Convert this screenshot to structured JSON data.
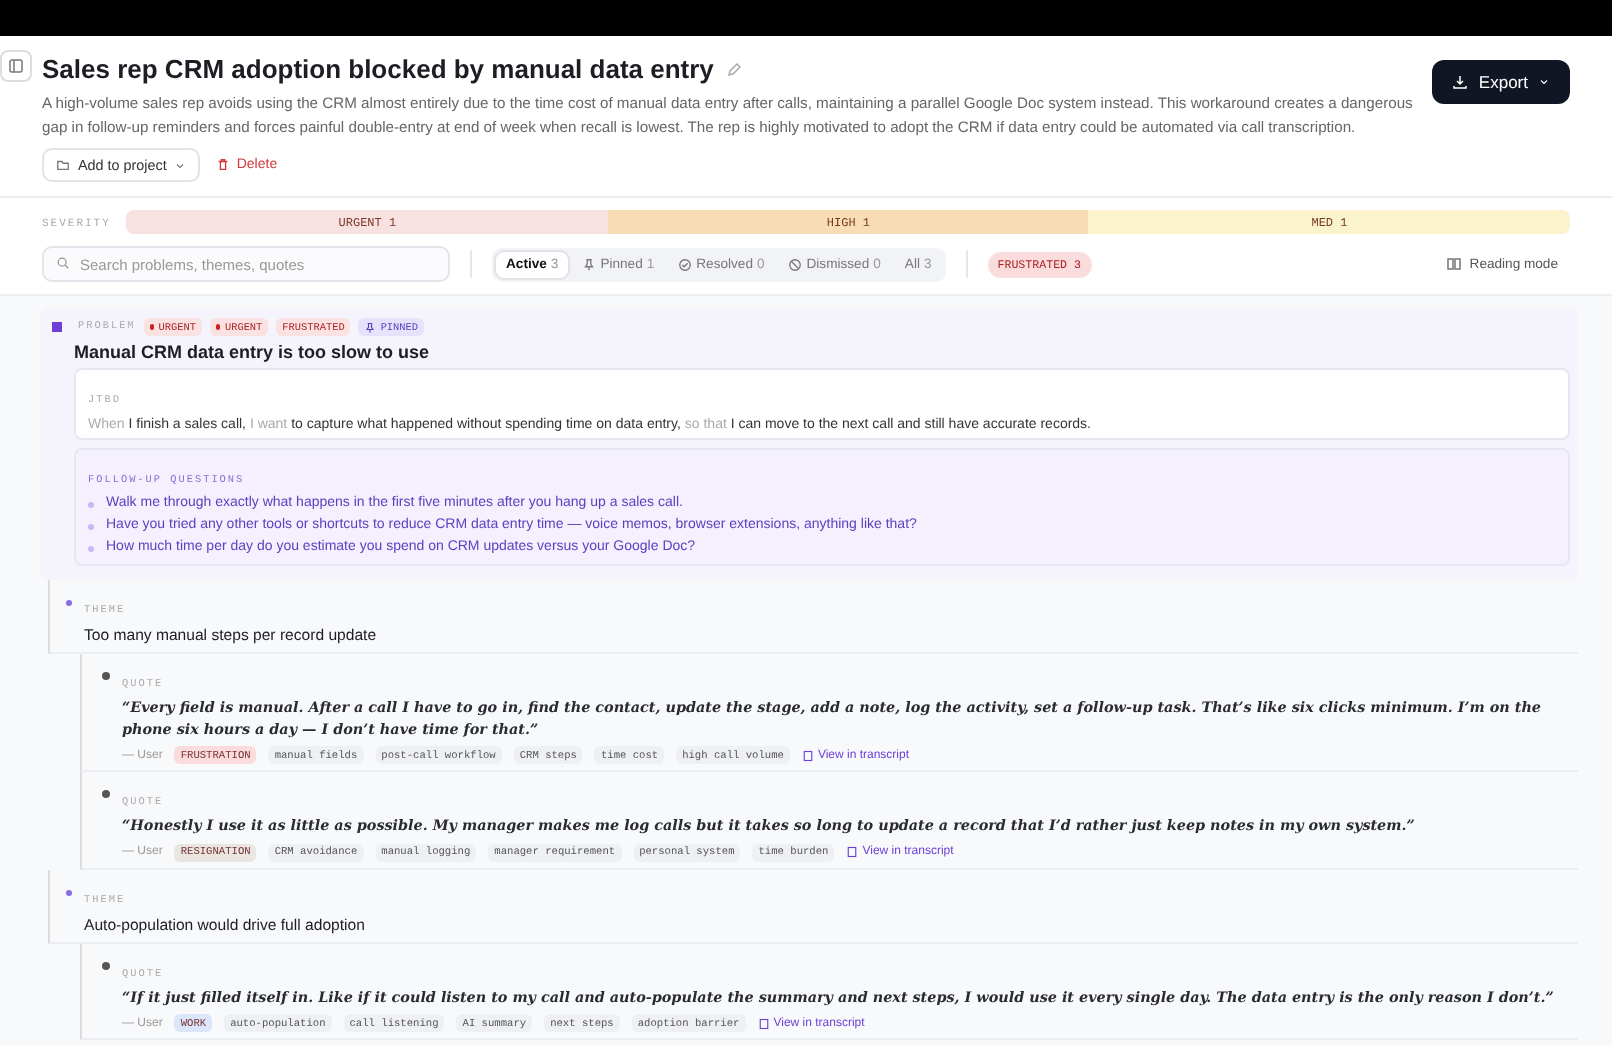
{
  "header": {
    "title": "Sales rep CRM adoption blocked by manual data entry",
    "description": "A high-volume sales rep avoids using the CRM almost entirely due to the time cost of manual data entry after calls, maintaining a parallel Google Doc system instead. This workaround creates a dangerous gap in follow-up reminders and forces painful double-entry at end of week when recall is lowest. The rep is highly motivated to adopt the CRM if data entry could be automated via call transcription.",
    "add_to_project": "Add to project",
    "delete": "Delete",
    "export": "Export"
  },
  "severity": {
    "label": "SEVERITY",
    "segments": [
      {
        "label": "URGENT 1",
        "color": "#f8e1e1"
      },
      {
        "label": "HIGH 1",
        "color": "#f8dcb4"
      },
      {
        "label": "MED 1",
        "color": "#fbf3cc"
      }
    ]
  },
  "filters": {
    "search_placeholder": "Search problems, themes, quotes",
    "tabs": [
      {
        "label": "Active",
        "count": "3",
        "selected": true,
        "kind": "plain"
      },
      {
        "label": "Pinned",
        "count": "1",
        "selected": false,
        "kind": "pin"
      },
      {
        "label": "Resolved",
        "count": "0",
        "selected": false,
        "kind": "check"
      },
      {
        "label": "Dismissed",
        "count": "0",
        "selected": false,
        "kind": "ban"
      },
      {
        "label": "All",
        "count": "3",
        "selected": false,
        "kind": "plain"
      }
    ],
    "emotion": {
      "label": "FRUSTRATED",
      "count": "3"
    },
    "reading_mode": "Reading mode"
  },
  "problem": {
    "label": "PROBLEM",
    "tags": [
      {
        "label": "URGENT",
        "kind": "severity"
      },
      {
        "label": "URGENT",
        "kind": "severity"
      },
      {
        "label": "FRUSTRATED",
        "kind": "emotion"
      },
      {
        "label": "PINNED",
        "kind": "pinned"
      }
    ],
    "title": "Manual CRM data entry is too slow to use",
    "jtbd": {
      "label": "JTBD",
      "parts": [
        {
          "text": "When",
          "kind": "keyword"
        },
        {
          "text": "I finish a sales call,",
          "kind": "body"
        },
        {
          "text": "I want",
          "kind": "keyword"
        },
        {
          "text": "to capture what happened without spending time on data entry,",
          "kind": "body"
        },
        {
          "text": "so that",
          "kind": "keyword"
        },
        {
          "text": "I can move to the next call and still have accurate records.",
          "kind": "body"
        }
      ]
    },
    "followups": {
      "label": "FOLLOW-UP QUESTIONS",
      "items": [
        "Walk me through exactly what happens in the first five minutes after you hang up a sales call.",
        "Have you tried any other tools or shortcuts to reduce CRM data entry time — voice memos, browser extensions, anything like that?",
        "How much time per day do you estimate you spend on CRM updates versus your Google Doc?"
      ]
    },
    "themes": [
      {
        "label": "THEME",
        "title": "Too many manual steps per record update",
        "quotes": [
          {
            "label": "QUOTE",
            "text": "“Every field is manual. After a call I have to go in, find the contact, update the stage, add a note, log the activity, set a follow-up task. That’s like six clicks minimum. I’m on the phone six hours a day — I don’t have time for that.”",
            "speaker": "— User",
            "emotion": {
              "label": "FRUSTRATION",
              "color": "#fbdcdc"
            },
            "tags": [
              "manual fields",
              "post-call workflow",
              "CRM steps",
              "time cost",
              "high call volume"
            ],
            "link": "View in transcript"
          },
          {
            "label": "QUOTE",
            "text": "“Honestly I use it as little as possible. My manager makes me log calls but it takes so long to update a record that I’d rather just keep notes in my own system.”",
            "speaker": "— User",
            "emotion": {
              "label": "RESIGNATION",
              "color": "#e9e6e1"
            },
            "tags": [
              "CRM avoidance",
              "manual logging",
              "manager requirement",
              "personal system",
              "time burden"
            ],
            "link": "View in transcript"
          }
        ]
      },
      {
        "label": "THEME",
        "title": "Auto-population would drive full adoption",
        "quotes": [
          {
            "label": "QUOTE",
            "text": "“If it just filled itself in. Like if it could listen to my call and auto-populate the summary and next steps, I would use it every single day. The data entry is the only reason I don’t.”",
            "speaker": "— User",
            "emotion": {
              "label": "WORK",
              "color": "#dbe6fb"
            },
            "tags": [
              "auto-population",
              "call listening",
              "AI summary",
              "next steps",
              "adoption barrier"
            ],
            "link": "View in transcript"
          }
        ]
      }
    ]
  }
}
